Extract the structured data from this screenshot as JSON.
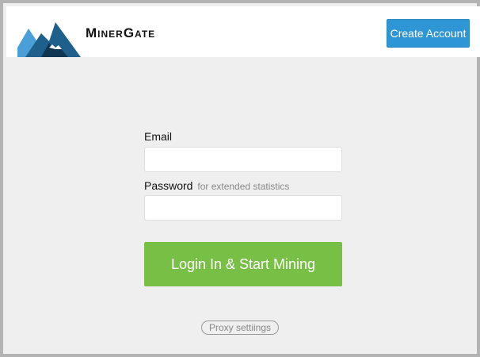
{
  "app": {
    "logo_text": "MinerGate",
    "logo_icon": "mountain-logo-icon"
  },
  "header": {
    "create_account_label": "Create Account"
  },
  "login_form": {
    "email_label": "Email",
    "email_value": "",
    "password_label": "Password",
    "password_hint": "for extended statistics",
    "password_value": "",
    "submit_label": "Login In & Start Mining"
  },
  "footer": {
    "proxy_settings_label": "Proxy settiings"
  },
  "colors": {
    "primary_blue": "#2f96d5",
    "login_green": "#78c045",
    "background": "#efefef",
    "logo_dark": "#1e5f8c",
    "logo_light": "#4a9fd8"
  }
}
